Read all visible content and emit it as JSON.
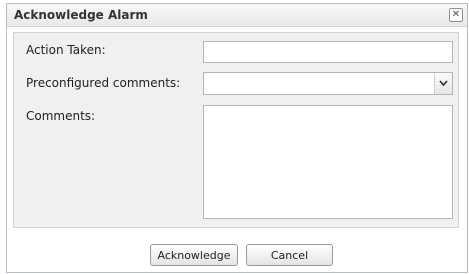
{
  "dialog": {
    "title": "Acknowledge Alarm",
    "close_glyph": "✕"
  },
  "form": {
    "action_taken": {
      "label": "Action Taken:",
      "value": ""
    },
    "preconfigured_comments": {
      "label": "Preconfigured comments:",
      "selected": ""
    },
    "comments": {
      "label": "Comments:",
      "value": ""
    }
  },
  "buttons": {
    "acknowledge": "Acknowledge",
    "cancel": "Cancel"
  },
  "colors": {
    "titlebar": "#ececec",
    "form_background": "#f0f0f0",
    "border": "#b5b5b5"
  },
  "icons": {
    "close": "close-icon",
    "dropdown": "chevron-down-icon"
  }
}
